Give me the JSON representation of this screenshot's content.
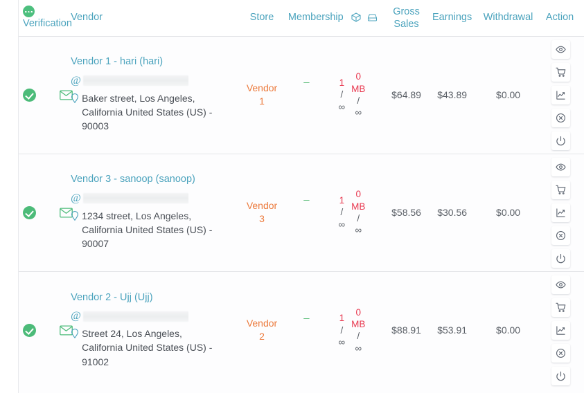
{
  "table": {
    "columns": {
      "verification": "Verification",
      "vendor": "Vendor",
      "store": "Store",
      "membership": "Membership",
      "gross_sales_line1": "Gross",
      "gross_sales_line2": "Sales",
      "earnings": "Earnings",
      "withdrawal": "Withdrawal",
      "action": "Action"
    },
    "header_icons": {
      "verification_status": "green-ellipsis-circle-icon",
      "product_limit": "cube-icon",
      "storage_limit": "hard-drive-icon"
    },
    "rows": [
      {
        "verified_icon": "check-circle-icon",
        "email_verified_icon": "envelope-icon",
        "vendor_name": "Vendor 1 - hari (hari)",
        "email_prefix": "@",
        "email_value": "",
        "address": "Baker street, Los Angeles, California United States (US) - 90003",
        "store_line1": "Vendor",
        "store_line2": "1",
        "membership": "–",
        "products_used": "1",
        "products_limit": "∞",
        "storage_used": "0",
        "storage_unit": "MB",
        "storage_limit": "∞",
        "gross_sales": "$64.89",
        "earnings": "$43.89",
        "withdrawal": "$0.00"
      },
      {
        "verified_icon": "check-circle-icon",
        "email_verified_icon": "envelope-icon",
        "vendor_name": "Vendor 3 - sanoop (sanoop)",
        "email_prefix": "@",
        "email_value": "",
        "address": "1234 street, Los Angeles, California United States (US) - 90007",
        "store_line1": "Vendor",
        "store_line2": "3",
        "membership": "–",
        "products_used": "1",
        "products_limit": "∞",
        "storage_used": "0",
        "storage_unit": "MB",
        "storage_limit": "∞",
        "gross_sales": "$58.56",
        "earnings": "$30.56",
        "withdrawal": "$0.00"
      },
      {
        "verified_icon": "check-circle-icon",
        "email_verified_icon": "envelope-icon",
        "vendor_name": "Vendor 2 - Ujj (Ujj)",
        "email_prefix": "@",
        "email_value": "",
        "address": "Street 24, Los Angeles, California United States (US) - 91002",
        "store_line1": "Vendor",
        "store_line2": "2",
        "membership": "–",
        "products_used": "1",
        "products_limit": "∞",
        "storage_used": "0",
        "storage_unit": "MB",
        "storage_limit": "∞",
        "gross_sales": "$88.91",
        "earnings": "$53.91",
        "withdrawal": "$0.00"
      }
    ],
    "actions": [
      {
        "name": "view-vendor",
        "icon": "eye-icon"
      },
      {
        "name": "view-orders",
        "icon": "shopping-cart-icon"
      },
      {
        "name": "view-reports",
        "icon": "chart-icon"
      },
      {
        "name": "disable-vendor",
        "icon": "x-circle-icon"
      },
      {
        "name": "toggle-vendor-status",
        "icon": "power-icon"
      }
    ]
  },
  "colors": {
    "header_link": "#4ba3bd",
    "vendor_link": "#4ba3bd",
    "store_link": "#ec7a3c",
    "verified_green": "#4cbb79",
    "quota_red": "#e8384f",
    "text": "#5b6067"
  }
}
